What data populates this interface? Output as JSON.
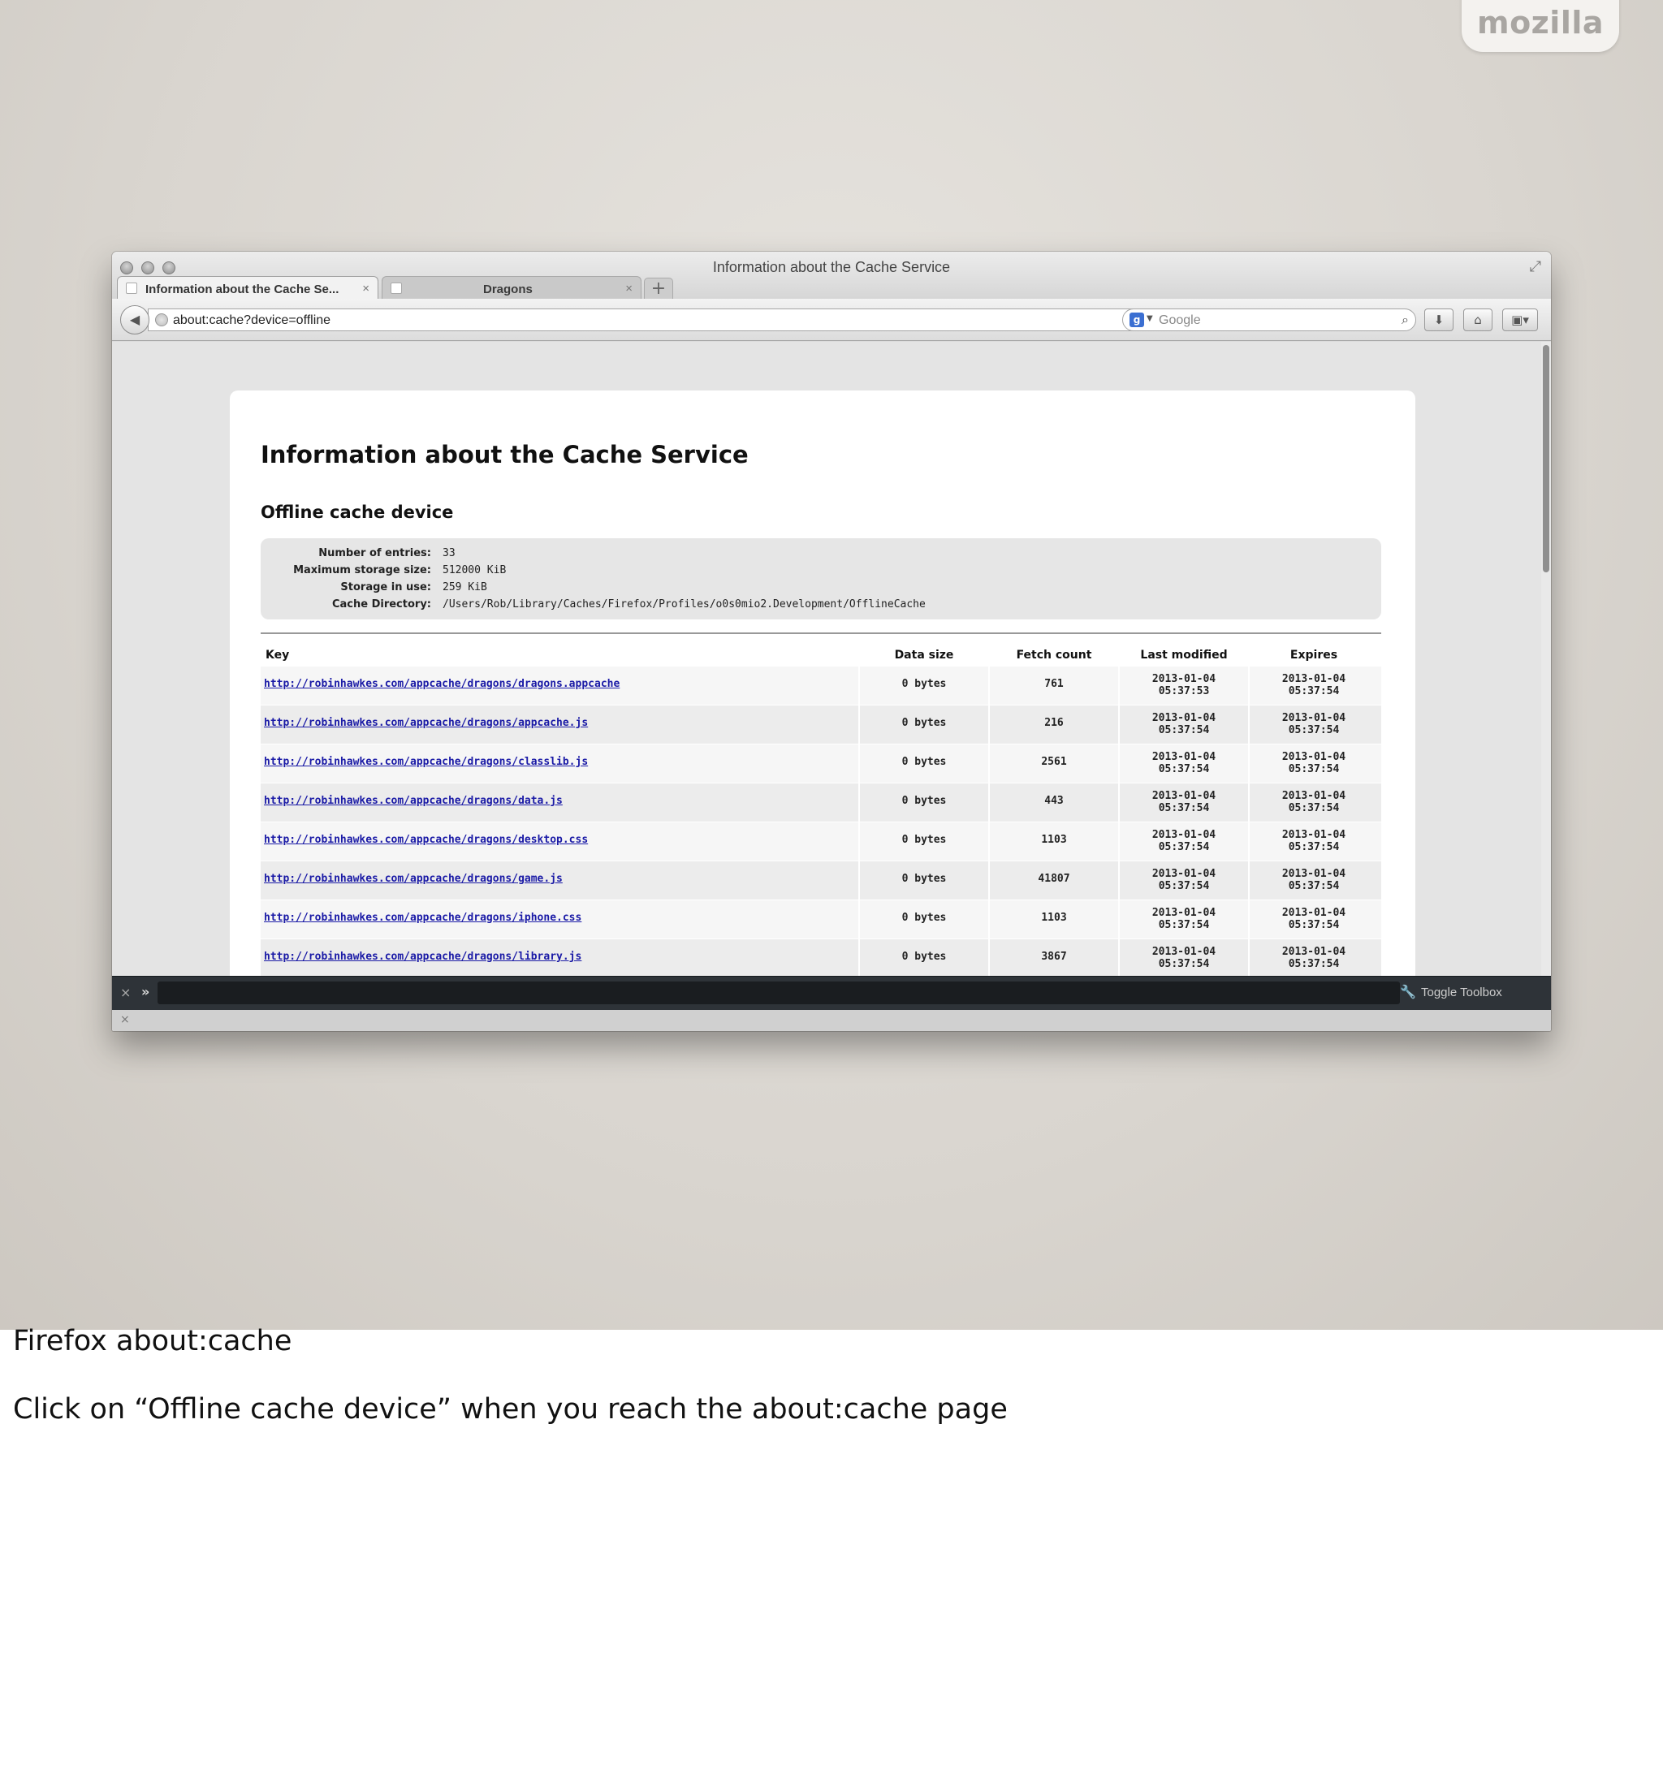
{
  "slide": {
    "logo": "mozilla",
    "caption_title": "Firefox about:cache",
    "caption_body": "Click on “Offline cache device” when you reach the about:cache page"
  },
  "browser": {
    "window_title": "Information about the Cache Service",
    "tabs": [
      {
        "label": "Information about the Cache Se...",
        "active": true
      },
      {
        "label": "Dragons",
        "active": false
      }
    ],
    "url": "about:cache?device=offline",
    "search_placeholder": "Google",
    "devtools_toggle_label": "Toggle Toolbox"
  },
  "page": {
    "title": "Information about the Cache Service",
    "section_title": "Offline cache device",
    "info": [
      {
        "label": "Number of entries:",
        "value": "33"
      },
      {
        "label": "Maximum storage size:",
        "value": "512000 KiB"
      },
      {
        "label": "Storage in use:",
        "value": "259 KiB"
      },
      {
        "label": "Cache Directory:",
        "value": "/Users/Rob/Library/Caches/Firefox/Profiles/o0s0mio2.Development/OfflineCache"
      }
    ],
    "table": {
      "columns": [
        "Key",
        "Data size",
        "Fetch count",
        "Last modified",
        "Expires"
      ],
      "rows": [
        {
          "key": "http://robinhawkes.com/appcache/dragons/dragons.appcache",
          "size": "0 bytes",
          "fetch": "761",
          "mod_date": "2013-01-04",
          "mod_time": "05:37:53",
          "exp_date": "2013-01-04",
          "exp_time": "05:37:54"
        },
        {
          "key": "http://robinhawkes.com/appcache/dragons/appcache.js",
          "size": "0 bytes",
          "fetch": "216",
          "mod_date": "2013-01-04",
          "mod_time": "05:37:54",
          "exp_date": "2013-01-04",
          "exp_time": "05:37:54"
        },
        {
          "key": "http://robinhawkes.com/appcache/dragons/classlib.js",
          "size": "0 bytes",
          "fetch": "2561",
          "mod_date": "2013-01-04",
          "mod_time": "05:37:54",
          "exp_date": "2013-01-04",
          "exp_time": "05:37:54"
        },
        {
          "key": "http://robinhawkes.com/appcache/dragons/data.js",
          "size": "0 bytes",
          "fetch": "443",
          "mod_date": "2013-01-04",
          "mod_time": "05:37:54",
          "exp_date": "2013-01-04",
          "exp_time": "05:37:54"
        },
        {
          "key": "http://robinhawkes.com/appcache/dragons/desktop.css",
          "size": "0 bytes",
          "fetch": "1103",
          "mod_date": "2013-01-04",
          "mod_time": "05:37:54",
          "exp_date": "2013-01-04",
          "exp_time": "05:37:54"
        },
        {
          "key": "http://robinhawkes.com/appcache/dragons/game.js",
          "size": "0 bytes",
          "fetch": "41807",
          "mod_date": "2013-01-04",
          "mod_time": "05:37:54",
          "exp_date": "2013-01-04",
          "exp_time": "05:37:54"
        },
        {
          "key": "http://robinhawkes.com/appcache/dragons/iphone.css",
          "size": "0 bytes",
          "fetch": "1103",
          "mod_date": "2013-01-04",
          "mod_time": "05:37:54",
          "exp_date": "2013-01-04",
          "exp_time": "05:37:54"
        },
        {
          "key": "http://robinhawkes.com/appcache/dragons/library.js",
          "size": "0 bytes",
          "fetch": "3867",
          "mod_date": "2013-01-04",
          "mod_time": "05:37:54",
          "exp_date": "2013-01-04",
          "exp_time": "05:37:54"
        }
      ]
    }
  },
  "colors": {
    "link": "#1a1aa6",
    "devtools_bg": "#2e3338"
  }
}
